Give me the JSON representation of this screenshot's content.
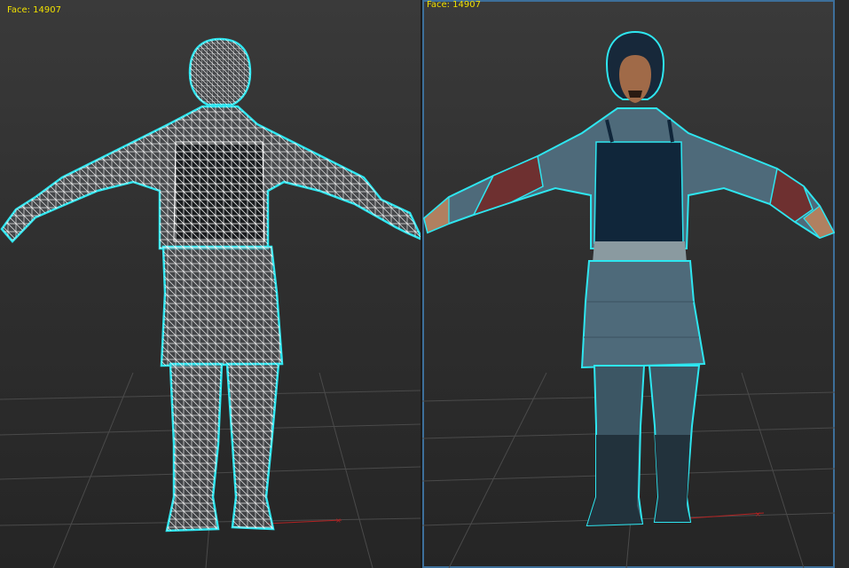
{
  "viewports": [
    {
      "id": "left",
      "stats_label": "Face: 14907",
      "shading": "wireframe"
    },
    {
      "id": "right",
      "stats_label": "Face: 14907",
      "shading": "textured",
      "active": true
    }
  ],
  "colors": {
    "selection_outline": "#2ee6f0",
    "wire": "#ffffff",
    "grid": "#4a4a4a",
    "axis_x": "#b22222",
    "stats_text": "#f0e000",
    "active_frame": "#3d6f9a"
  }
}
